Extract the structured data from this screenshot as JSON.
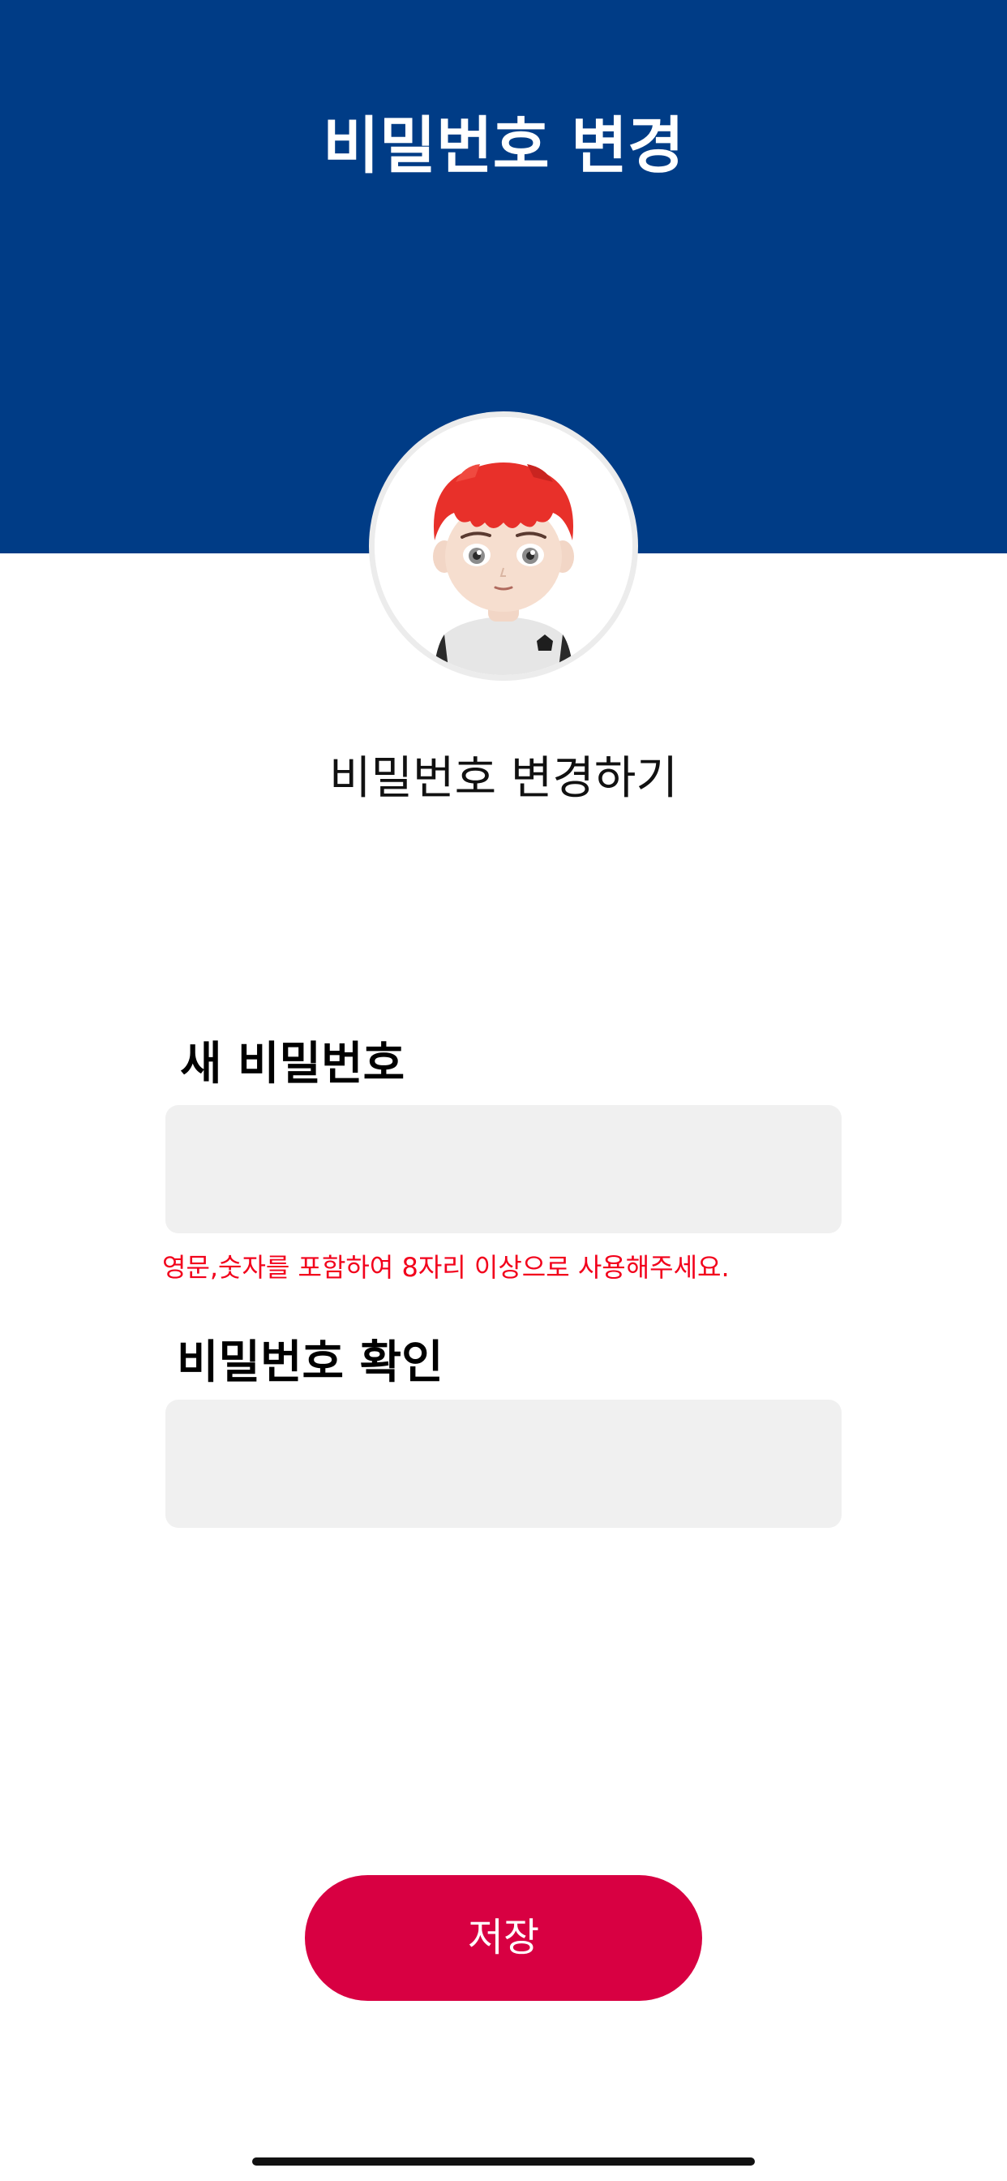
{
  "header": {
    "title": "비밀번호 변경",
    "background_color": "#003C86"
  },
  "profile": {
    "avatar_icon": "character-avatar-icon"
  },
  "subtitle": "비밀번호 변경하기",
  "form": {
    "new_password": {
      "label": "새 비밀번호",
      "value": "",
      "hint": "영문,숫자를 포함하여 8자리 이상으로 사용해주세요."
    },
    "confirm_password": {
      "label": "비밀번호 확인",
      "value": ""
    }
  },
  "save_button": {
    "label": "저장",
    "color": "#D80042"
  },
  "hint_color": "#F2001B"
}
